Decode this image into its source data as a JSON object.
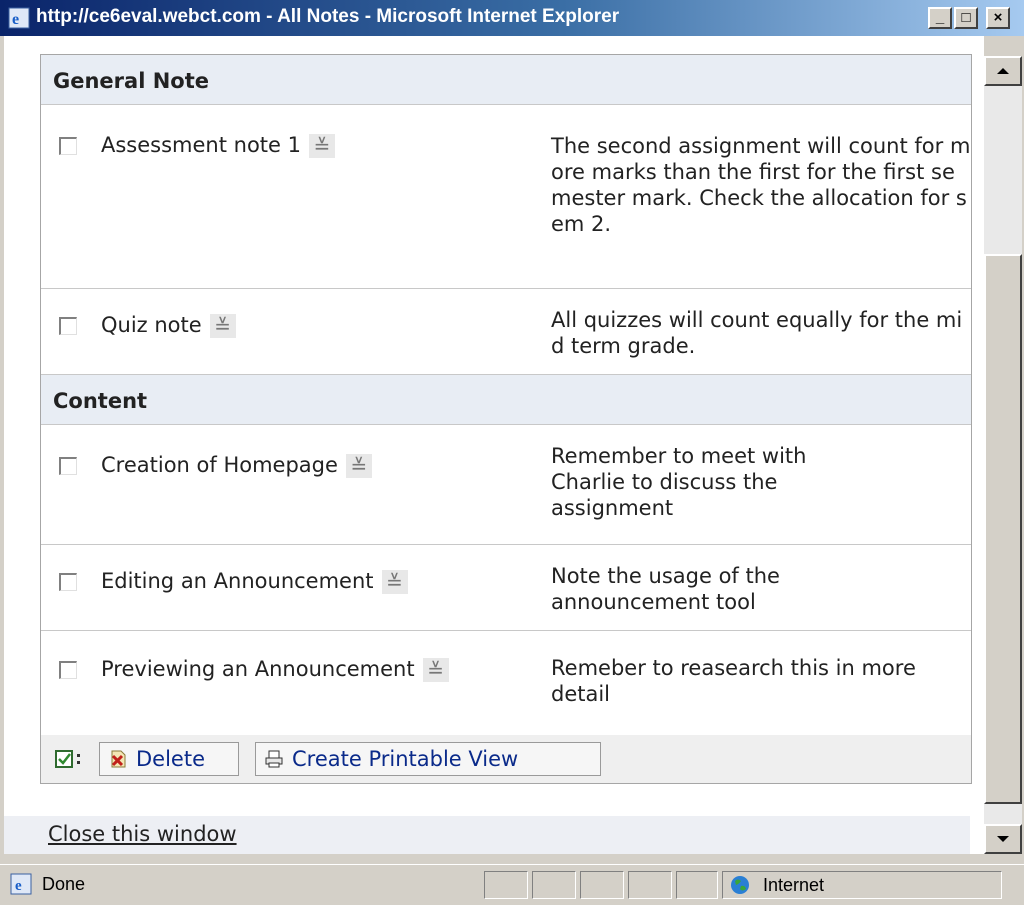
{
  "window": {
    "title": "http://ce6eval.webct.com - All Notes - Microsoft Internet Explorer"
  },
  "title_buttons": {
    "minimize": "_",
    "maximize": "□",
    "close": "×"
  },
  "sections": [
    {
      "header": "General Note",
      "rows": [
        {
          "title": "Assessment note 1",
          "note": "The second assignment will count for more marks than the first for the first semester mark. Check the allocation for sem 2."
        },
        {
          "title": "Quiz note",
          "note": "All quizzes will count equally for the mid term grade."
        }
      ]
    },
    {
      "header": "Content",
      "rows": [
        {
          "title": "Creation of Homepage",
          "note": "Remember to meet with Charlie to discuss the assignment"
        },
        {
          "title": "Editing an Announcement",
          "note": "Note the usage of the announcement tool"
        },
        {
          "title": "Previewing an Announcement",
          "note": "Remeber to reasearch this in more detail"
        }
      ]
    }
  ],
  "actions": {
    "delete_label": "Delete",
    "printable_label": "Create Printable View"
  },
  "close_link": "Close this window",
  "status": {
    "text": "Done",
    "zone": "Internet"
  }
}
